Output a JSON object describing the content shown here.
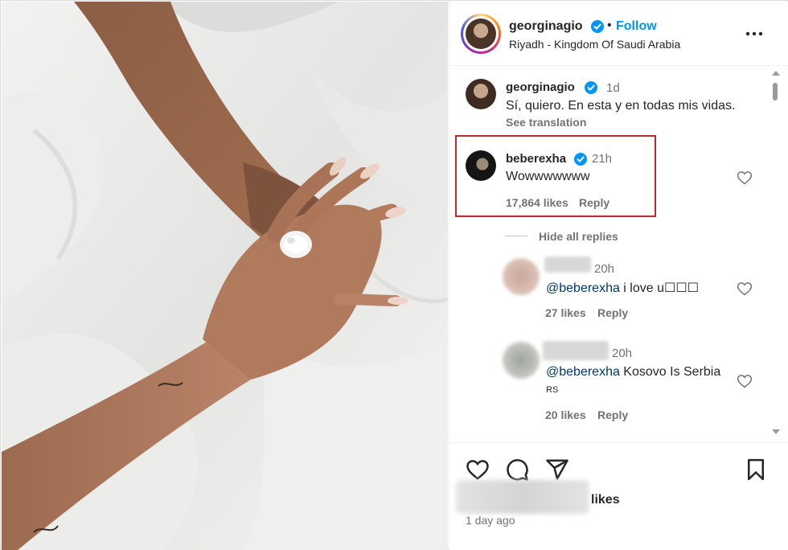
{
  "post": {
    "author": "georginagio",
    "follow_label": "Follow",
    "dot": "•",
    "location": "Riyadh - Kingdom Of Saudi Arabia"
  },
  "comments": {
    "caption": {
      "user": "georginagio",
      "time": "1d",
      "text": "Sí, quiero. En esta y en todas mis vidas.",
      "see_translation": "See translation"
    },
    "highlighted": {
      "user": "beberexha",
      "time": "21h",
      "text": "Wowwwwwww",
      "likes": "17,864 likes",
      "reply": "Reply"
    },
    "hide_replies": "Hide all replies",
    "replies": [
      {
        "time": "20h",
        "mention": "@beberexha",
        "text": " i love u☐☐☐",
        "likes": "27 likes",
        "reply": "Reply"
      },
      {
        "time": "20h",
        "mention": "@beberexha",
        "text": " Kosovo Is Serbia",
        "flag": "RS",
        "likes": "20 likes",
        "reply": "Reply"
      }
    ]
  },
  "footer": {
    "likes_label": "likes",
    "time_ago": "1 day ago"
  },
  "icons": [
    "verified-icon",
    "more-options-icon",
    "heart-icon",
    "comment-icon",
    "share-icon",
    "bookmark-icon"
  ],
  "colors": {
    "accent": "#0095f6",
    "highlight_border": "#c0282e",
    "mention": "#00376b",
    "muted": "#737373"
  }
}
